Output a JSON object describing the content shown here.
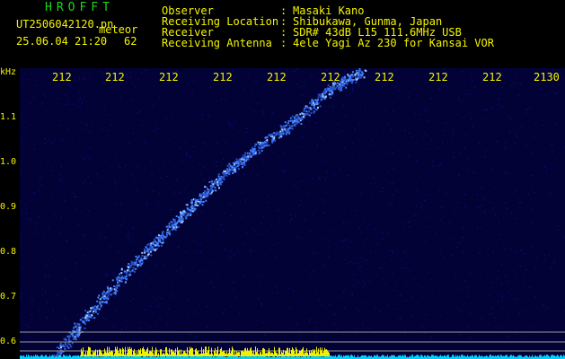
{
  "app_title": "HROFFT",
  "file": {
    "name": "UT2506042120.pn",
    "mode": "meteor",
    "date_time": "25.06.04 21:20",
    "count": "62"
  },
  "header": [
    {
      "label": "Observer",
      "value": "Masaki Kano"
    },
    {
      "label": "Receiving Location",
      "value": "Shibukawa, Gunma, Japan"
    },
    {
      "label": "Receiver",
      "value": "SDR# 43dB L15 111.6MHz USB"
    },
    {
      "label": "Receiving Antenna",
      "value": "4ele Yagi Az 230 for Kansai VOR"
    }
  ],
  "y_unit": "kHz",
  "y_ticks": [
    "1.1",
    "1.0",
    "0.9",
    "0.8",
    "0.7",
    "0.6"
  ],
  "x_ticks": [
    "212",
    "212",
    "212",
    "212",
    "212",
    "212",
    "212",
    "212",
    "212",
    "2130"
  ],
  "colors": {
    "text": "#f5f500",
    "title": "#19d919",
    "background": "#020236",
    "signal": "#4080ff",
    "noise": "#00d0ff",
    "audio": "#f0f000"
  }
}
